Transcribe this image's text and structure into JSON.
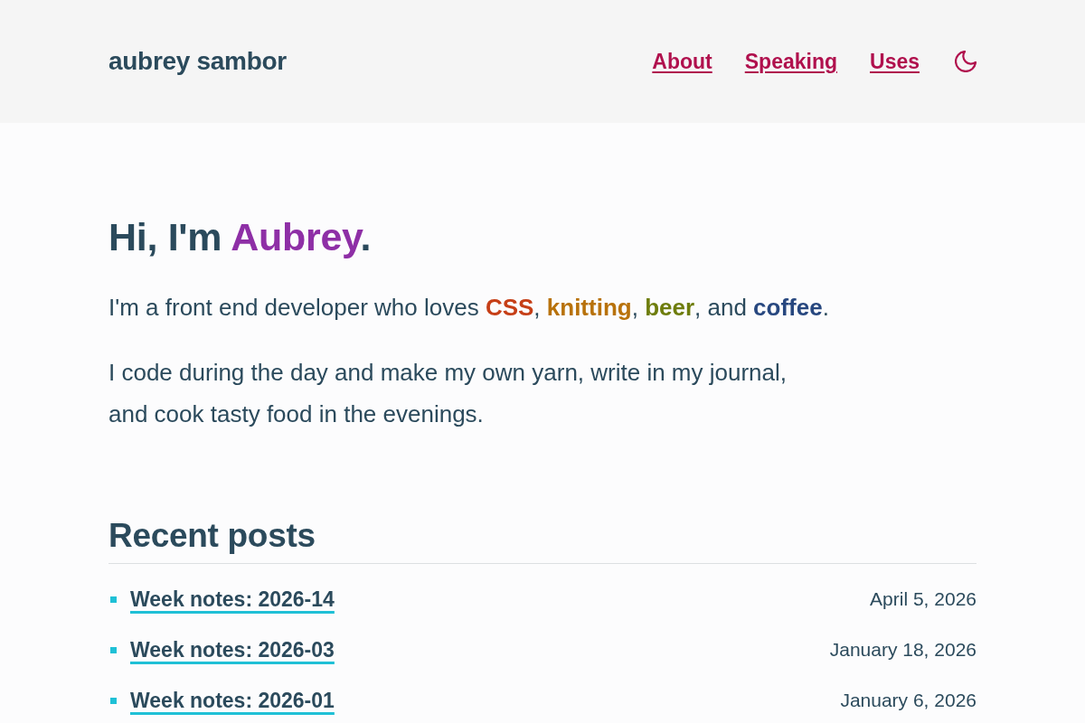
{
  "site": {
    "title": "aubrey sambor"
  },
  "nav": [
    "About",
    "Speaking",
    "Uses"
  ],
  "hero": {
    "heading": [
      {
        "text": "Hi, I'm "
      },
      {
        "text": "Aubrey",
        "color": "#8e2fa6"
      },
      {
        "text": "."
      }
    ],
    "paragraphs": [
      {
        "parts": [
          {
            "text": "I'm a front end developer who loves "
          },
          {
            "text": "CSS",
            "color": "#c63f17"
          },
          {
            "text": ", "
          },
          {
            "text": "knitting",
            "color": "#b8720b"
          },
          {
            "text": ", "
          },
          {
            "text": "beer",
            "color": "#6e7d0c"
          },
          {
            "text": ", and "
          },
          {
            "text": "coffee",
            "color": "#27477f"
          },
          {
            "text": "."
          }
        ]
      },
      {
        "parts": [
          {
            "text": "I code during the day and make my own yarn, write in my journal, and cook tasty food in the evenings."
          }
        ]
      }
    ]
  },
  "recent_posts": {
    "heading": "Recent posts",
    "posts": [
      {
        "title": "Week notes: 2026-14",
        "date": "April 5, 2026"
      },
      {
        "title": "Week notes: 2026-03",
        "date": "January 18, 2026"
      },
      {
        "title": "Week notes: 2026-01",
        "date": "January 6, 2026"
      }
    ]
  }
}
